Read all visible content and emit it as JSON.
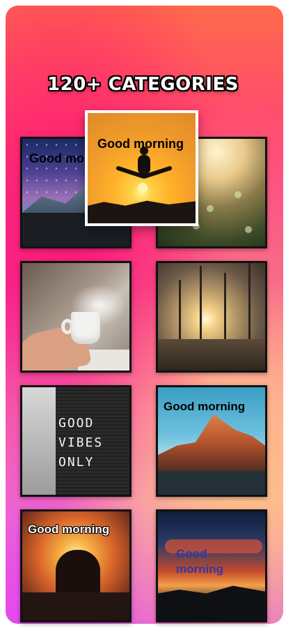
{
  "headline": "120+ CATEGORIES",
  "featured": {
    "caption": "Good morning"
  },
  "tiles": [
    {
      "caption": "Good mo"
    },
    {
      "caption": ""
    },
    {
      "caption": ""
    },
    {
      "caption": ""
    },
    {
      "text_lines": [
        "GOOD",
        "VIBES",
        "ONLY"
      ]
    },
    {
      "caption": "Good morning"
    },
    {
      "caption": "Good morning"
    },
    {
      "caption_lines": [
        "Good",
        "morning"
      ]
    }
  ],
  "colors": {
    "caption_dark": "#000000",
    "caption_light": "#ffffff",
    "caption_blue": "#2a3aa8"
  }
}
